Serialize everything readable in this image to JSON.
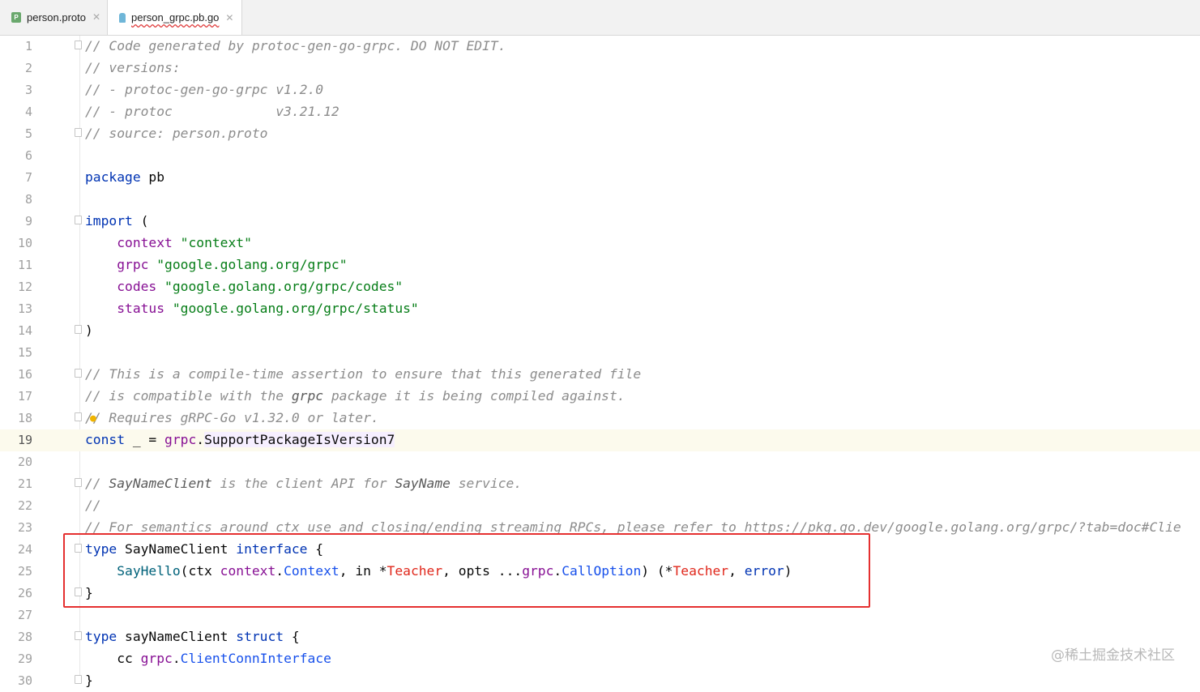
{
  "tabs": [
    {
      "label": "person.proto",
      "icon": "proto-file-icon",
      "badge": "P"
    },
    {
      "label": "person_grpc.pb.go",
      "icon": "go-file-icon",
      "active": true
    }
  ],
  "current_line": 19,
  "lines": [
    [
      [
        "c",
        "// Code generated by protoc-gen-go-grpc. DO NOT EDIT."
      ]
    ],
    [
      [
        "c",
        "// versions:"
      ]
    ],
    [
      [
        "c",
        "// - protoc-gen-go-grpc v1.2.0"
      ]
    ],
    [
      [
        "c",
        "// - protoc             v3.21.12"
      ]
    ],
    [
      [
        "c",
        "// source: person.proto"
      ]
    ],
    [],
    [
      [
        "k",
        "package"
      ],
      [
        "",
        " pb"
      ]
    ],
    [],
    [
      [
        "k",
        "import"
      ],
      [
        "",
        " ("
      ]
    ],
    [
      [
        "",
        "    "
      ],
      [
        "p",
        "context"
      ],
      [
        "",
        " "
      ],
      [
        "s",
        "\"context\""
      ]
    ],
    [
      [
        "",
        "    "
      ],
      [
        "p",
        "grpc"
      ],
      [
        "",
        " "
      ],
      [
        "s",
        "\"google.golang.org/grpc\""
      ]
    ],
    [
      [
        "",
        "    "
      ],
      [
        "p",
        "codes"
      ],
      [
        "",
        " "
      ],
      [
        "s",
        "\"google.golang.org/grpc/codes\""
      ]
    ],
    [
      [
        "",
        "    "
      ],
      [
        "p",
        "status"
      ],
      [
        "",
        " "
      ],
      [
        "s",
        "\"google.golang.org/grpc/status\""
      ]
    ],
    [
      [
        "",
        ")"
      ]
    ],
    [],
    [
      [
        "c",
        "// This is a compile-time assertion to ensure that this generated file"
      ]
    ],
    [
      [
        "c",
        "// is compatible with the "
      ],
      [
        "cb",
        "grpc"
      ],
      [
        "c",
        " package it is being compiled against."
      ]
    ],
    [
      [
        "c",
        "// Requires gRPC-Go v1.32.0 or later."
      ]
    ],
    [
      [
        "k",
        "const"
      ],
      [
        "",
        " _ = "
      ],
      [
        "p",
        "grpc"
      ],
      [
        ".",
        ""
      ],
      [
        "",
        ""
      ],
      [
        "hl",
        "SupportPackageIsVersion7"
      ]
    ],
    [],
    [
      [
        "c",
        "// "
      ],
      [
        "cb",
        "SayNameClient"
      ],
      [
        "c",
        " is the client API for "
      ],
      [
        "cb",
        "SayName"
      ],
      [
        "c",
        " service."
      ]
    ],
    [
      [
        "c",
        "//"
      ]
    ],
    [
      [
        "c",
        "// For semantics around ctx use and closing/ending streaming RPCs, please refer to https://pkg.go.dev/google.golang.org/grpc/?tab=doc#Clie"
      ]
    ],
    [
      [
        "k",
        "type"
      ],
      [
        "",
        " SayNameClient "
      ],
      [
        "k",
        "interface"
      ],
      [
        "",
        " {"
      ]
    ],
    [
      [
        "",
        "    "
      ],
      [
        "f",
        "SayHello"
      ],
      [
        "",
        "(ctx "
      ],
      [
        "p",
        "context"
      ],
      [
        "",
        "."
      ],
      [
        "t",
        "Context"
      ],
      [
        "",
        ", in *"
      ],
      [
        "r",
        "Teacher"
      ],
      [
        "",
        ", opts ..."
      ],
      [
        "p",
        "grpc"
      ],
      [
        "",
        "."
      ],
      [
        "t",
        "CallOption"
      ],
      [
        "",
        ") (*"
      ],
      [
        "r",
        "Teacher"
      ],
      [
        "",
        ", "
      ],
      [
        "k",
        "error"
      ],
      [
        "",
        ")"
      ]
    ],
    [
      [
        "",
        "}"
      ]
    ],
    [],
    [
      [
        "k",
        "type"
      ],
      [
        "",
        " sayNameClient "
      ],
      [
        "k",
        "struct"
      ],
      [
        "",
        " {"
      ]
    ],
    [
      [
        "",
        "    cc "
      ],
      [
        "p",
        "grpc"
      ],
      [
        "",
        "."
      ],
      [
        "t",
        "ClientConnInterface"
      ]
    ],
    [
      [
        "",
        "}"
      ]
    ]
  ],
  "fold_lines": [
    1,
    5,
    9,
    14,
    16,
    18,
    21,
    24,
    26,
    28,
    30
  ],
  "bulb_line": 18,
  "watermark": "@稀土掘金技术社区",
  "colors": {
    "keyword": "#0033b3",
    "string": "#067d17",
    "package": "#871094",
    "type": "#1750eb",
    "local_type": "#e0281c",
    "function": "#00627a",
    "comment": "#8c8c8c",
    "highlight_box": "#e53030"
  }
}
